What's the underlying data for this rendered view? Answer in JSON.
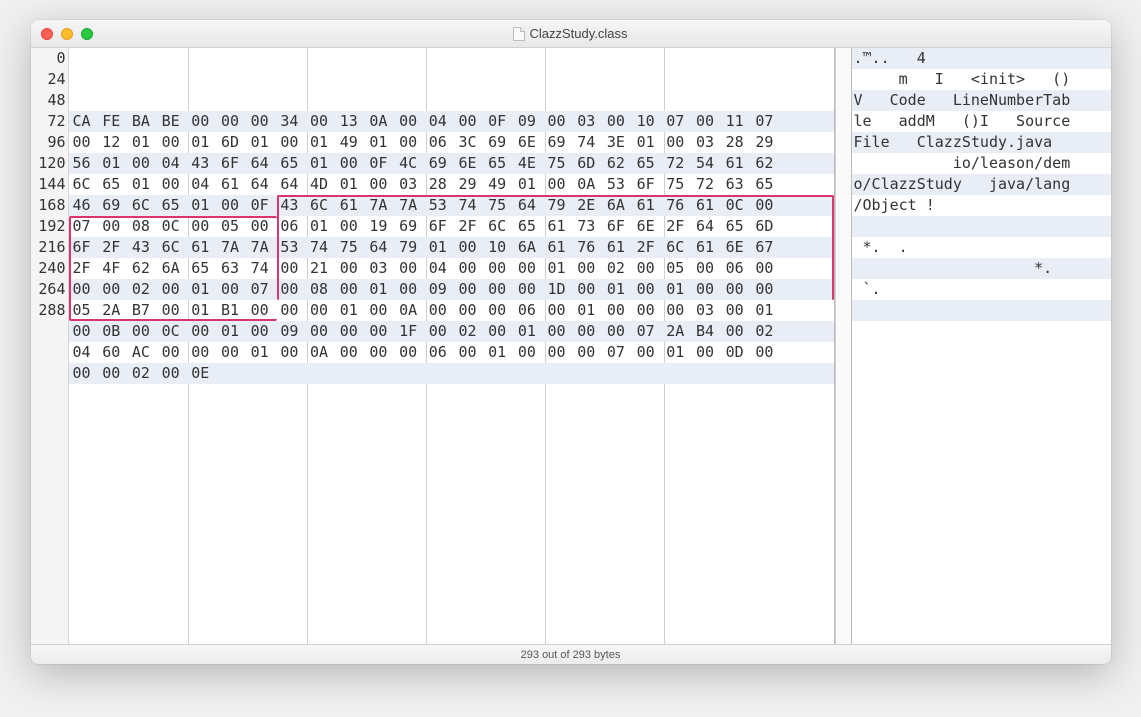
{
  "window": {
    "title": "ClazzStudy.class"
  },
  "status": "293 out of 293 bytes",
  "offsets": [
    "0",
    "24",
    "48",
    "72",
    "96",
    "120",
    "144",
    "168",
    "192",
    "216",
    "240",
    "264",
    "288"
  ],
  "hex": [
    [
      "CA",
      "FE",
      "BA",
      "BE",
      "00",
      "00",
      "00",
      "34",
      "00",
      "13",
      "0A",
      "00",
      "04",
      "00",
      "0F",
      "09",
      "00",
      "03",
      "00",
      "10",
      "07",
      "00",
      "11",
      "07"
    ],
    [
      "00",
      "12",
      "01",
      "00",
      "01",
      "6D",
      "01",
      "00",
      "01",
      "49",
      "01",
      "00",
      "06",
      "3C",
      "69",
      "6E",
      "69",
      "74",
      "3E",
      "01",
      "00",
      "03",
      "28",
      "29"
    ],
    [
      "56",
      "01",
      "00",
      "04",
      "43",
      "6F",
      "64",
      "65",
      "01",
      "00",
      "0F",
      "4C",
      "69",
      "6E",
      "65",
      "4E",
      "75",
      "6D",
      "62",
      "65",
      "72",
      "54",
      "61",
      "62"
    ],
    [
      "6C",
      "65",
      "01",
      "00",
      "04",
      "61",
      "64",
      "64",
      "4D",
      "01",
      "00",
      "03",
      "28",
      "29",
      "49",
      "01",
      "00",
      "0A",
      "53",
      "6F",
      "75",
      "72",
      "63",
      "65"
    ],
    [
      "46",
      "69",
      "6C",
      "65",
      "01",
      "00",
      "0F",
      "43",
      "6C",
      "61",
      "7A",
      "7A",
      "53",
      "74",
      "75",
      "64",
      "79",
      "2E",
      "6A",
      "61",
      "76",
      "61",
      "0C",
      "00"
    ],
    [
      "07",
      "00",
      "08",
      "0C",
      "00",
      "05",
      "00",
      "06",
      "01",
      "00",
      "19",
      "69",
      "6F",
      "2F",
      "6C",
      "65",
      "61",
      "73",
      "6F",
      "6E",
      "2F",
      "64",
      "65",
      "6D"
    ],
    [
      "6F",
      "2F",
      "43",
      "6C",
      "61",
      "7A",
      "7A",
      "53",
      "74",
      "75",
      "64",
      "79",
      "01",
      "00",
      "10",
      "6A",
      "61",
      "76",
      "61",
      "2F",
      "6C",
      "61",
      "6E",
      "67"
    ],
    [
      "2F",
      "4F",
      "62",
      "6A",
      "65",
      "63",
      "74",
      "00",
      "21",
      "00",
      "03",
      "00",
      "04",
      "00",
      "00",
      "00",
      "01",
      "00",
      "02",
      "00",
      "05",
      "00",
      "06",
      "00"
    ],
    [
      "00",
      "00",
      "02",
      "00",
      "01",
      "00",
      "07",
      "00",
      "08",
      "00",
      "01",
      "00",
      "09",
      "00",
      "00",
      "00",
      "1D",
      "00",
      "01",
      "00",
      "01",
      "00",
      "00",
      "00"
    ],
    [
      "05",
      "2A",
      "B7",
      "00",
      "01",
      "B1",
      "00",
      "00",
      "00",
      "01",
      "00",
      "0A",
      "00",
      "00",
      "00",
      "06",
      "00",
      "01",
      "00",
      "00",
      "00",
      "03",
      "00",
      "01"
    ],
    [
      "00",
      "0B",
      "00",
      "0C",
      "00",
      "01",
      "00",
      "09",
      "00",
      "00",
      "00",
      "1F",
      "00",
      "02",
      "00",
      "01",
      "00",
      "00",
      "00",
      "07",
      "2A",
      "B4",
      "00",
      "02"
    ],
    [
      "04",
      "60",
      "AC",
      "00",
      "00",
      "00",
      "01",
      "00",
      "0A",
      "00",
      "00",
      "00",
      "06",
      "00",
      "01",
      "00",
      "00",
      "00",
      "07",
      "00",
      "01",
      "00",
      "0D",
      "00"
    ],
    [
      "00",
      "00",
      "02",
      "00",
      "0E"
    ]
  ],
  "ascii": [
    ".™..   4",
    "     m   I   <init>   ()",
    "V   Code   LineNumberTab",
    "le   addM   ()I   Source",
    "File   ClazzStudy.java  ",
    "           io/leason/dem",
    "o/ClazzStudy   java/lang",
    "/Object !",
    "",
    " *.  .",
    "                    *.  ",
    " `.",
    ""
  ],
  "column_seps": [
    4,
    8,
    12,
    16,
    20
  ],
  "highlight": {
    "first_row": 7,
    "first_col": 7,
    "last_row": 12,
    "last_col": 5
  }
}
